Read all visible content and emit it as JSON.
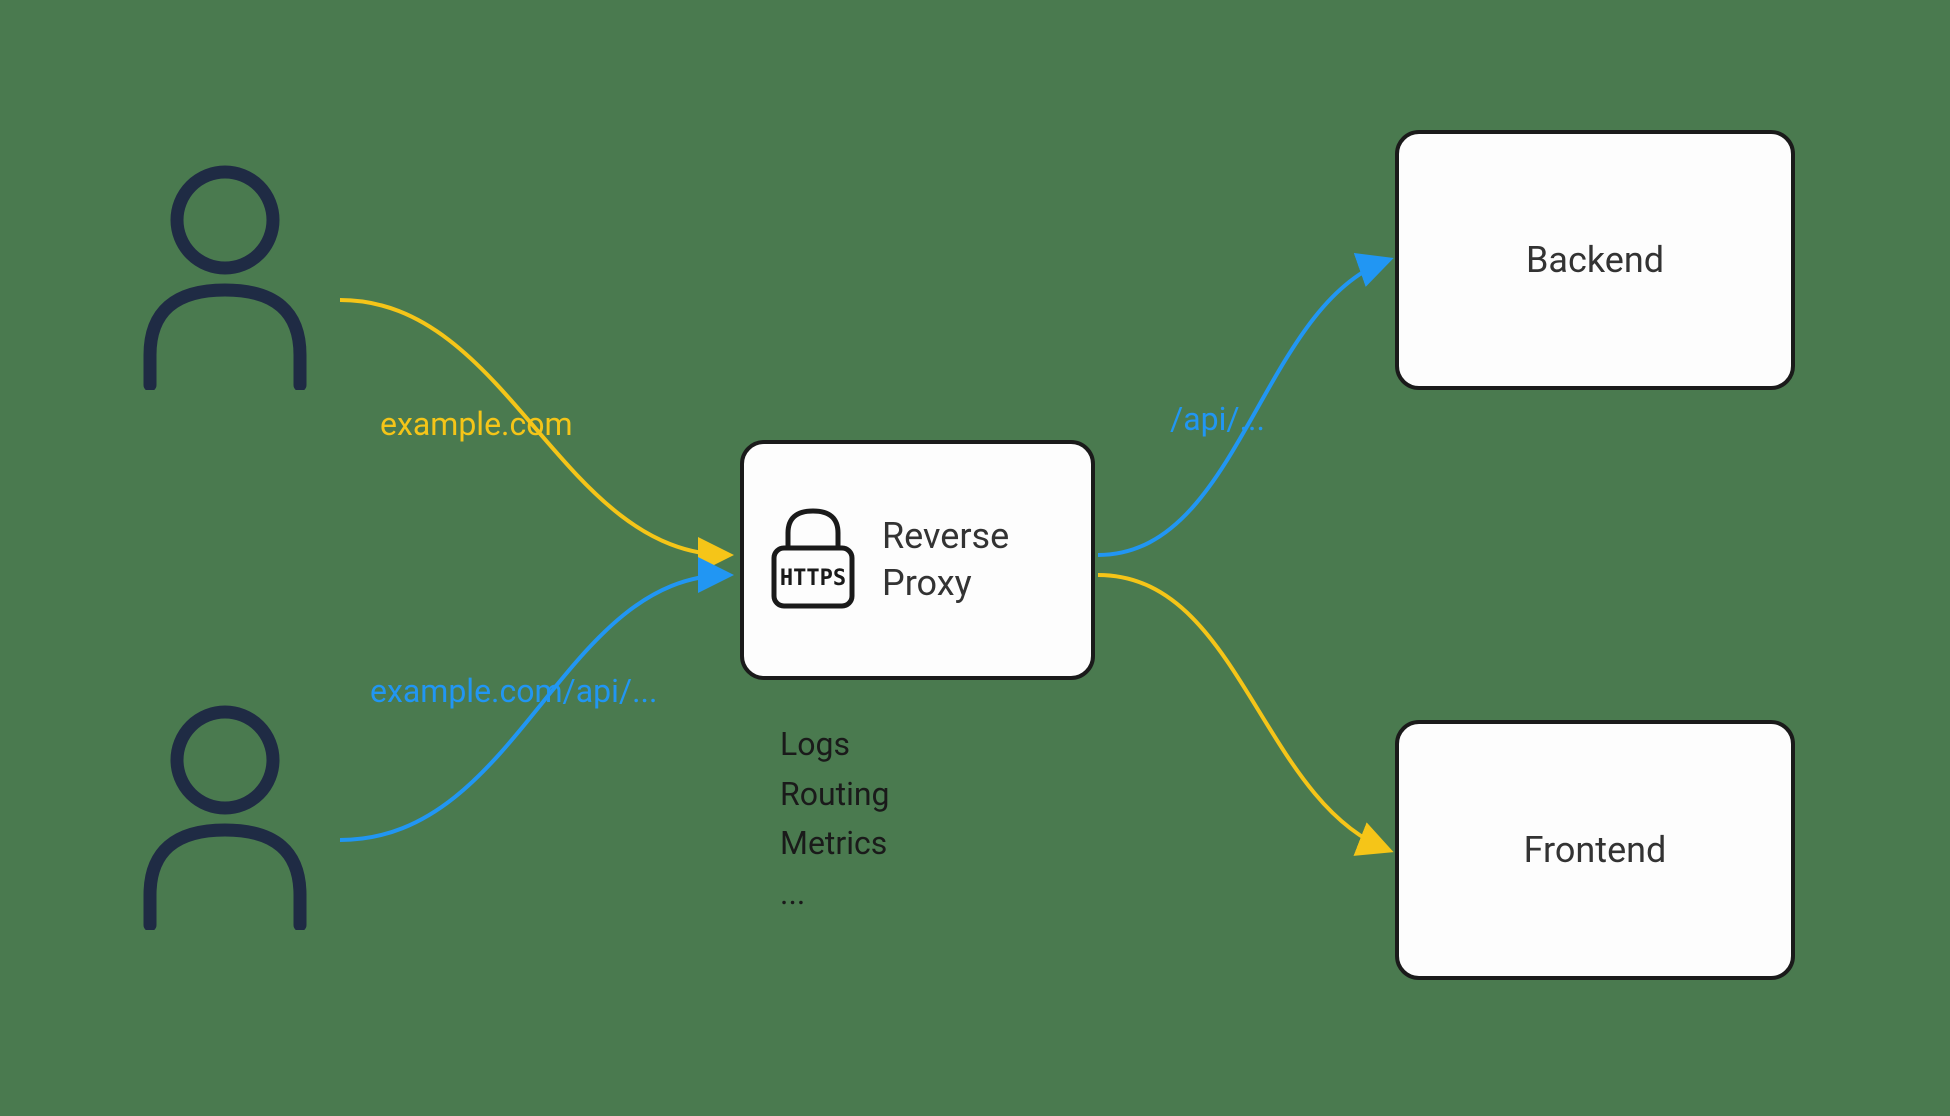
{
  "users": {
    "top_request": "example.com",
    "bottom_request": "example.com/api/..."
  },
  "proxy": {
    "title_line1": "Reverse",
    "title_line2": "Proxy",
    "lock_label": "HTTPS",
    "meta1": "Logs",
    "meta2": "Routing",
    "meta3": "Metrics",
    "meta4": "..."
  },
  "routes": {
    "api_path": "/api/..."
  },
  "nodes": {
    "backend": "Backend",
    "frontend": "Frontend"
  },
  "colors": {
    "yellow": "#f5c518",
    "blue": "#2196f3",
    "outline": "#1f2b44",
    "bg": "#4a7a4f"
  }
}
